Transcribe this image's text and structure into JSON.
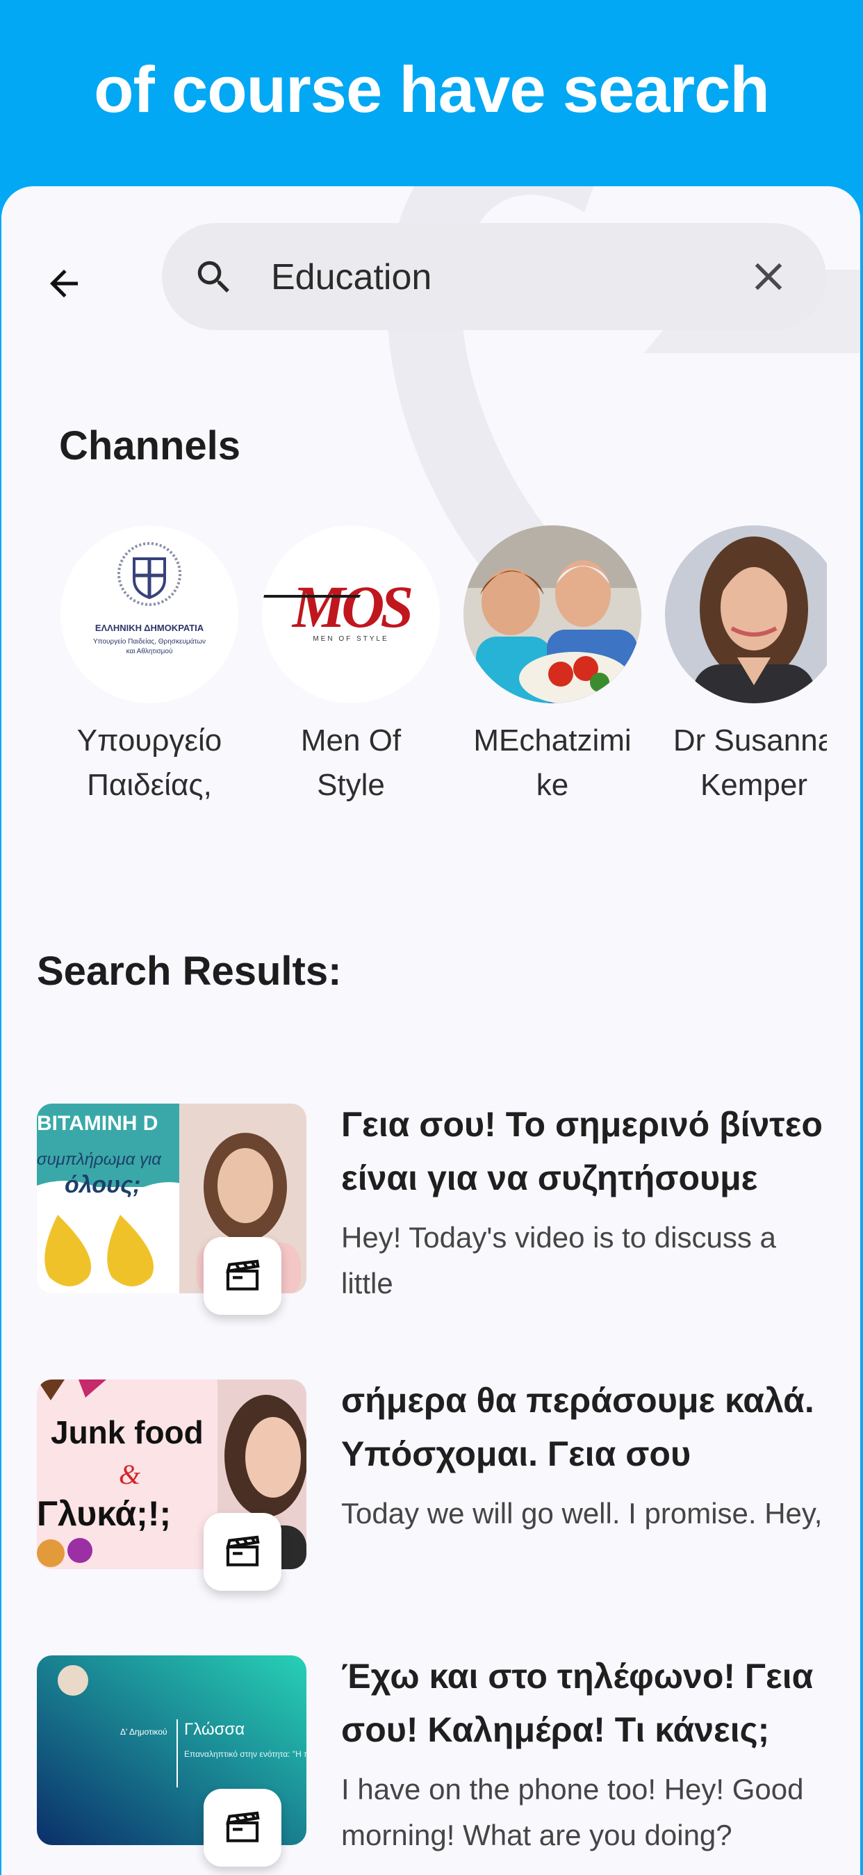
{
  "banner": {
    "title": "of course have search"
  },
  "search": {
    "query": "Education",
    "placeholder": ""
  },
  "channels": {
    "heading": "Channels",
    "items": [
      {
        "name": "Υπουργείο\nΠαιδείας,",
        "logo_title": "ΕΛΛΗΝΙΚΗ ΔΗΜΟΚΡΑΤΙΑ",
        "logo_sub1": "Υπουργείο Παιδείας, Θρησκευμάτων",
        "logo_sub2": "και Αθλητισμού"
      },
      {
        "name": "Men Of\nStyle",
        "logo_text": "MOS",
        "logo_sub": "MEN OF STYLE"
      },
      {
        "name": "MEchatzimi\nke"
      },
      {
        "name": "Dr Susanna\nKemper"
      }
    ]
  },
  "results": {
    "heading": "Search Results:",
    "items": [
      {
        "title": "Γεια σου! Το σημερινό βίντεο είναι για να συζητήσουμε",
        "description": "Hey! Today's video is to discuss a little",
        "thumb_line1": "ΒΙΤΑΜΙΝΗ D",
        "thumb_line2": "συμπλήρωμα για",
        "thumb_line3": "όλους;"
      },
      {
        "title": "σήμερα θα περάσουμε καλά. Υπόσχομαι. Γεια σου",
        "description": "Today we will go well. I promise. Hey,",
        "thumb_line1": "Junk food",
        "thumb_line2": "&",
        "thumb_line3": "Γλυκά;!;"
      },
      {
        "title": "Έχω και στο τηλέφωνο! Γεια σου! Καλημέρα! Τι κάνεις;",
        "description": "I have on the phone too! Hey! Good morning! What are you doing?",
        "thumb_line1": "Δ' Δημοτικού",
        "thumb_line2": "Γλώσσα",
        "thumb_line3": "Επαναληπτικό στην ενότητα: \"Η παράσταση αρχίζει\""
      }
    ]
  },
  "colors": {
    "banner": "#02a8f3",
    "screen": "#f8f8fd",
    "search_bg": "#ebebef"
  }
}
